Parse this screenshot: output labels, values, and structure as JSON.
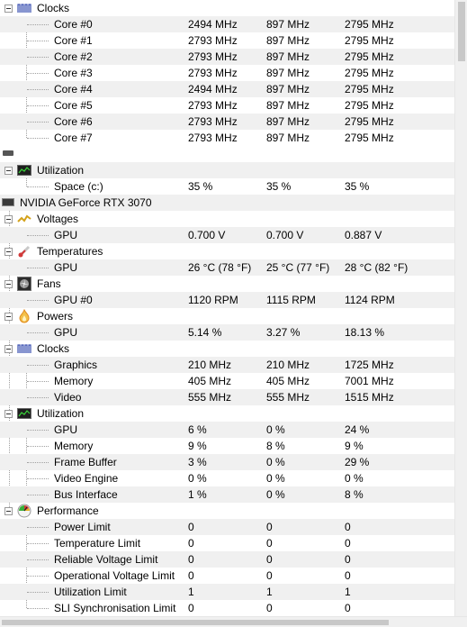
{
  "cpu_clocks": {
    "label": "Clocks",
    "rows": [
      {
        "name": "Core #0",
        "v1": "2494 MHz",
        "v2": "897 MHz",
        "v3": "2795 MHz"
      },
      {
        "name": "Core #1",
        "v1": "2793 MHz",
        "v2": "897 MHz",
        "v3": "2795 MHz"
      },
      {
        "name": "Core #2",
        "v1": "2793 MHz",
        "v2": "897 MHz",
        "v3": "2795 MHz"
      },
      {
        "name": "Core #3",
        "v1": "2793 MHz",
        "v2": "897 MHz",
        "v3": "2795 MHz"
      },
      {
        "name": "Core #4",
        "v1": "2494 MHz",
        "v2": "897 MHz",
        "v3": "2795 MHz"
      },
      {
        "name": "Core #5",
        "v1": "2793 MHz",
        "v2": "897 MHz",
        "v3": "2795 MHz"
      },
      {
        "name": "Core #6",
        "v1": "2793 MHz",
        "v2": "897 MHz",
        "v3": "2795 MHz"
      },
      {
        "name": "Core #7",
        "v1": "2793 MHz",
        "v2": "897 MHz",
        "v3": "2795 MHz"
      }
    ]
  },
  "drive": {
    "utilization": {
      "label": "Utilization",
      "rows": [
        {
          "name": "Space (c:)",
          "v1": "35 %",
          "v2": "35 %",
          "v3": "35 %"
        }
      ]
    }
  },
  "gpu": {
    "name": "NVIDIA GeForce RTX 3070",
    "voltages": {
      "label": "Voltages",
      "rows": [
        {
          "name": "GPU",
          "v1": "0.700 V",
          "v2": "0.700 V",
          "v3": "0.887 V"
        }
      ]
    },
    "temperatures": {
      "label": "Temperatures",
      "rows": [
        {
          "name": "GPU",
          "v1": "26 °C  (78 °F)",
          "v2": "25 °C  (77 °F)",
          "v3": "28 °C  (82 °F)"
        }
      ]
    },
    "fans": {
      "label": "Fans",
      "rows": [
        {
          "name": "GPU #0",
          "v1": "1120 RPM",
          "v2": "1115 RPM",
          "v3": "1124 RPM"
        }
      ]
    },
    "powers": {
      "label": "Powers",
      "rows": [
        {
          "name": "GPU",
          "v1": "5.14 %",
          "v2": "3.27 %",
          "v3": "18.13 %"
        }
      ]
    },
    "clocks": {
      "label": "Clocks",
      "rows": [
        {
          "name": "Graphics",
          "v1": "210 MHz",
          "v2": "210 MHz",
          "v3": "1725 MHz"
        },
        {
          "name": "Memory",
          "v1": "405 MHz",
          "v2": "405 MHz",
          "v3": "7001 MHz"
        },
        {
          "name": "Video",
          "v1": "555 MHz",
          "v2": "555 MHz",
          "v3": "1515 MHz"
        }
      ]
    },
    "utilization": {
      "label": "Utilization",
      "rows": [
        {
          "name": "GPU",
          "v1": "6 %",
          "v2": "0 %",
          "v3": "24 %"
        },
        {
          "name": "Memory",
          "v1": "9 %",
          "v2": "8 %",
          "v3": "9 %"
        },
        {
          "name": "Frame Buffer",
          "v1": "3 %",
          "v2": "0 %",
          "v3": "29 %"
        },
        {
          "name": "Video Engine",
          "v1": "0 %",
          "v2": "0 %",
          "v3": "0 %"
        },
        {
          "name": "Bus Interface",
          "v1": "1 %",
          "v2": "0 %",
          "v3": "8 %"
        }
      ]
    },
    "performance": {
      "label": "Performance",
      "rows": [
        {
          "name": "Power Limit",
          "v1": "0",
          "v2": "0",
          "v3": "0"
        },
        {
          "name": "Temperature Limit",
          "v1": "0",
          "v2": "0",
          "v3": "0"
        },
        {
          "name": "Reliable Voltage Limit",
          "v1": "0",
          "v2": "0",
          "v3": "0"
        },
        {
          "name": "Operational Voltage Limit",
          "v1": "0",
          "v2": "0",
          "v3": "0"
        },
        {
          "name": "Utilization Limit",
          "v1": "1",
          "v2": "1",
          "v3": "1"
        },
        {
          "name": "SLI Synchronisation Limit",
          "v1": "0",
          "v2": "0",
          "v3": "0"
        }
      ]
    }
  },
  "colors": {
    "alt_row": "#f0f0f0",
    "tree_line": "#a0a0a0",
    "clock_icon": "#3a4fb0",
    "util_icon": "#2f7a2f",
    "voltage_icon": "#d4a21a",
    "temp_icon": "#d23a3a",
    "power_icon": "#e08a1e"
  }
}
